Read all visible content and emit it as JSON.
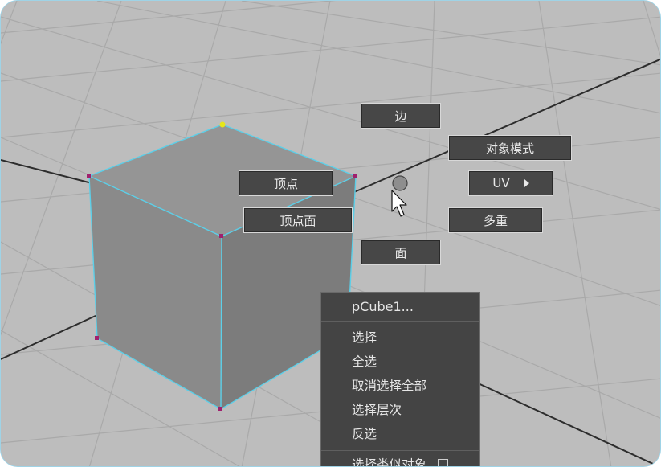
{
  "marking_menu": {
    "edge": "边",
    "object_mode": "对象模式",
    "vertex": "顶点",
    "uv": "UV",
    "vertex_face": "顶点面",
    "multi": "多重",
    "face": "面"
  },
  "context_menu": {
    "title": "pCube1...",
    "items": [
      "选择",
      "全选",
      "取消选择全部",
      "选择层次",
      "反选",
      "选择类似对象"
    ]
  },
  "colors": {
    "grid_background": "#b9b9b9",
    "grid_line": "#a6a6a6",
    "cube_face": "#8c8c8c",
    "wire_highlight": "#5ccfe8",
    "vertex_marker": "#a0206e",
    "selected_vertex": "#e6e619",
    "menu_background": "#444444"
  },
  "icons": [
    "arrow-cursor-icon",
    "submenu-arrow-icon",
    "checkbox-icon"
  ]
}
